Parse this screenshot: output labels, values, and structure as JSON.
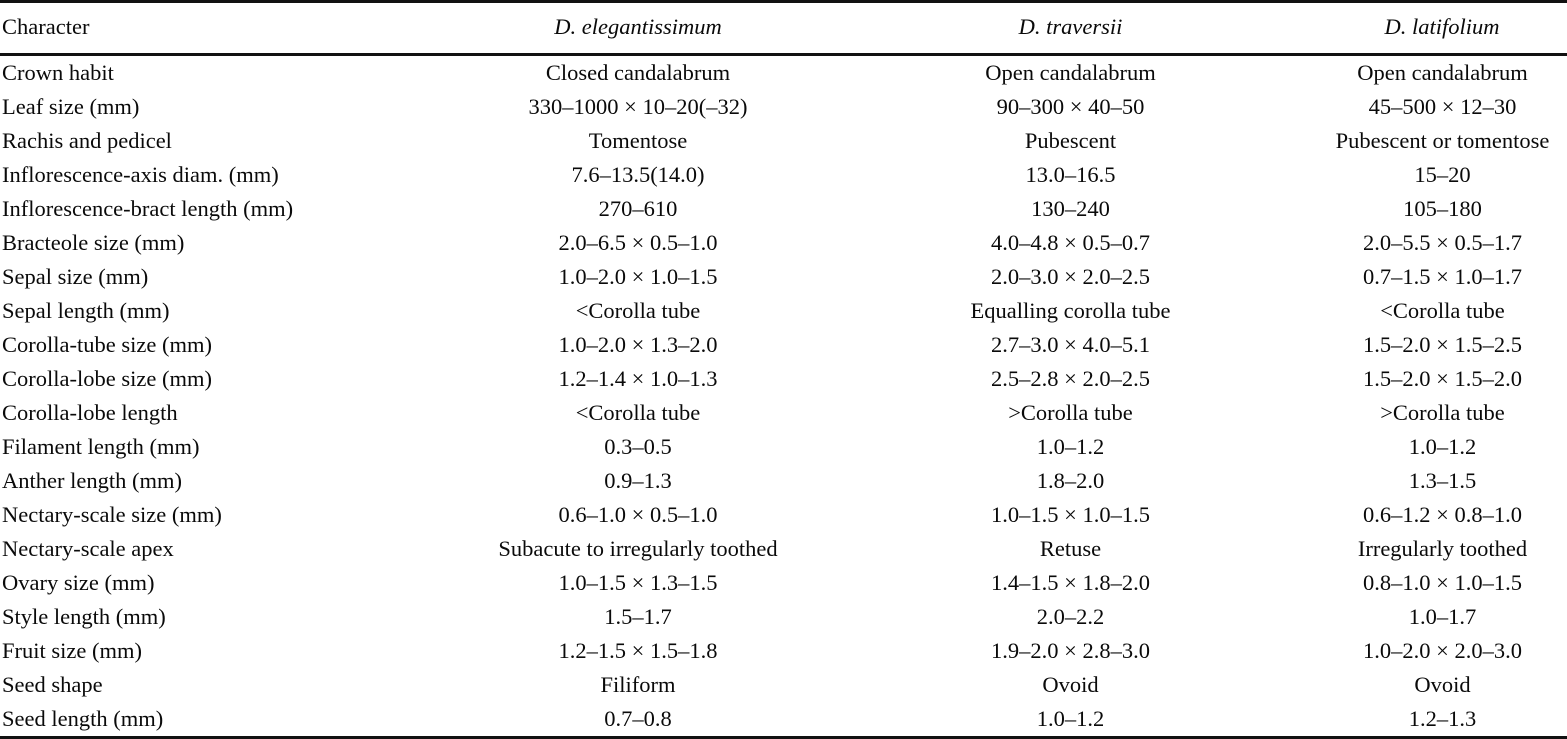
{
  "table": {
    "columns": [
      {
        "key": "character",
        "label": "Character",
        "italic": false,
        "align": "left"
      },
      {
        "key": "sp1",
        "label": "D. elegantissimum",
        "italic": true,
        "align": "center"
      },
      {
        "key": "sp2",
        "label": "D. traversii",
        "italic": true,
        "align": "center"
      },
      {
        "key": "sp3",
        "label": "D. latifolium",
        "italic": true,
        "align": "center"
      }
    ],
    "rows": [
      {
        "character": "Crown habit",
        "sp1": "Closed candalabrum",
        "sp2": "Open candalabrum",
        "sp3": "Open candalabrum"
      },
      {
        "character": "Leaf size (mm)",
        "sp1": "330–1000 × 10–20(–32)",
        "sp2": "90–300 × 40–50",
        "sp3": "45–500 × 12–30"
      },
      {
        "character": "Rachis and pedicel",
        "sp1": "Tomentose",
        "sp2": "Pubescent",
        "sp3": "Pubescent or tomentose"
      },
      {
        "character": "Inflorescence-axis diam. (mm)",
        "sp1": "7.6–13.5(14.0)",
        "sp2": "13.0–16.5",
        "sp3": "15–20"
      },
      {
        "character": "Inflorescence-bract length (mm)",
        "sp1": "270–610",
        "sp2": "130–240",
        "sp3": "105–180"
      },
      {
        "character": "Bracteole size (mm)",
        "sp1": "2.0–6.5 × 0.5–1.0",
        "sp2": "4.0–4.8 × 0.5–0.7",
        "sp3": "2.0–5.5 × 0.5–1.7"
      },
      {
        "character": "Sepal size (mm)",
        "sp1": "1.0–2.0 × 1.0–1.5",
        "sp2": "2.0–3.0 × 2.0–2.5",
        "sp3": "0.7–1.5 × 1.0–1.7"
      },
      {
        "character": "Sepal length (mm)",
        "sp1": "<Corolla tube",
        "sp2": "Equalling corolla tube",
        "sp3": "<Corolla tube"
      },
      {
        "character": "Corolla-tube size (mm)",
        "sp1": "1.0–2.0 × 1.3–2.0",
        "sp2": "2.7–3.0 × 4.0–5.1",
        "sp3": "1.5–2.0 × 1.5–2.5"
      },
      {
        "character": "Corolla-lobe size (mm)",
        "sp1": "1.2–1.4 × 1.0–1.3",
        "sp2": "2.5–2.8 × 2.0–2.5",
        "sp3": "1.5–2.0 × 1.5–2.0"
      },
      {
        "character": "Corolla-lobe length",
        "sp1": "<Corolla tube",
        "sp2": ">Corolla tube",
        "sp3": ">Corolla tube"
      },
      {
        "character": "Filament length (mm)",
        "sp1": "0.3–0.5",
        "sp2": "1.0–1.2",
        "sp3": "1.0–1.2"
      },
      {
        "character": "Anther length (mm)",
        "sp1": "0.9–1.3",
        "sp2": "1.8–2.0",
        "sp3": "1.3–1.5"
      },
      {
        "character": "Nectary-scale size (mm)",
        "sp1": "0.6–1.0 × 0.5–1.0",
        "sp2": "1.0–1.5 × 1.0–1.5",
        "sp3": "0.6–1.2 × 0.8–1.0"
      },
      {
        "character": "Nectary-scale apex",
        "sp1": "Subacute to irregularly toothed",
        "sp2": "Retuse",
        "sp3": "Irregularly toothed"
      },
      {
        "character": "Ovary size (mm)",
        "sp1": "1.0–1.5 × 1.3–1.5",
        "sp2": "1.4–1.5 × 1.8–2.0",
        "sp3": "0.8–1.0 × 1.0–1.5"
      },
      {
        "character": "Style length (mm)",
        "sp1": "1.5–1.7",
        "sp2": "2.0–2.2",
        "sp3": "1.0–1.7"
      },
      {
        "character": "Fruit size (mm)",
        "sp1": "1.2–1.5 × 1.5–1.8",
        "sp2": "1.9–2.0 × 2.8–3.0",
        "sp3": "1.0–2.0 × 2.0–3.0"
      },
      {
        "character": "Seed shape",
        "sp1": "Filiform",
        "sp2": "Ovoid",
        "sp3": "Ovoid"
      },
      {
        "character": "Seed length (mm)",
        "sp1": "0.7–0.8",
        "sp2": "1.0–1.2",
        "sp3": "1.2–1.3"
      }
    ]
  },
  "style": {
    "rule_color": "#111111",
    "text_color": "#0a0a0a",
    "background": "#ffffff"
  }
}
